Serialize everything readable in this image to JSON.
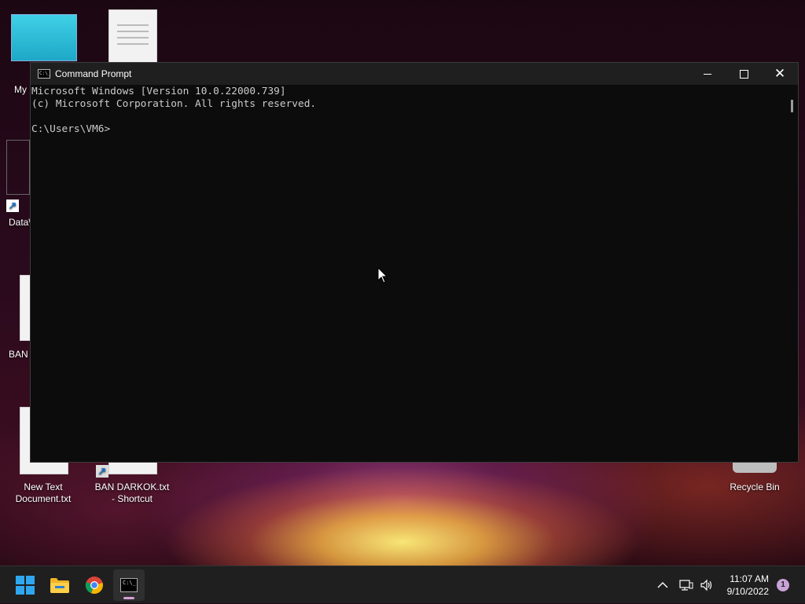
{
  "desktop": {
    "icons": [
      {
        "label": "My"
      },
      {
        "label": "Data\\"
      },
      {
        "label": "BAN"
      },
      {
        "label": "New Text Document.txt"
      },
      {
        "label": "BAN DARKOK.txt - Shortcut"
      },
      {
        "label": "Recycle Bin"
      }
    ]
  },
  "window": {
    "title": "Command Prompt",
    "icon": "cmd-icon",
    "icon_text": "C:\\_",
    "console_lines": [
      "Microsoft Windows [Version 10.0.22000.739]",
      "(c) Microsoft Corporation. All rights reserved.",
      "",
      "C:\\Users\\VM6>"
    ],
    "controls": {
      "minimize": "minimize-icon",
      "maximize": "maximize-icon",
      "close": "close-icon",
      "close_glyph": "✕"
    }
  },
  "taskbar": {
    "apps": [
      {
        "name": "Start",
        "icon": "windows-start-icon"
      },
      {
        "name": "File Explorer",
        "icon": "folder-icon"
      },
      {
        "name": "Google Chrome",
        "icon": "chrome-icon"
      },
      {
        "name": "Command Prompt",
        "icon": "cmd-icon",
        "active": true
      }
    ],
    "tray": {
      "chevron": "chevron-up-icon",
      "network": "network-icon",
      "volume": "volume-icon",
      "time": "11:07 AM",
      "date": "9/10/2022",
      "notifications": "1"
    }
  }
}
